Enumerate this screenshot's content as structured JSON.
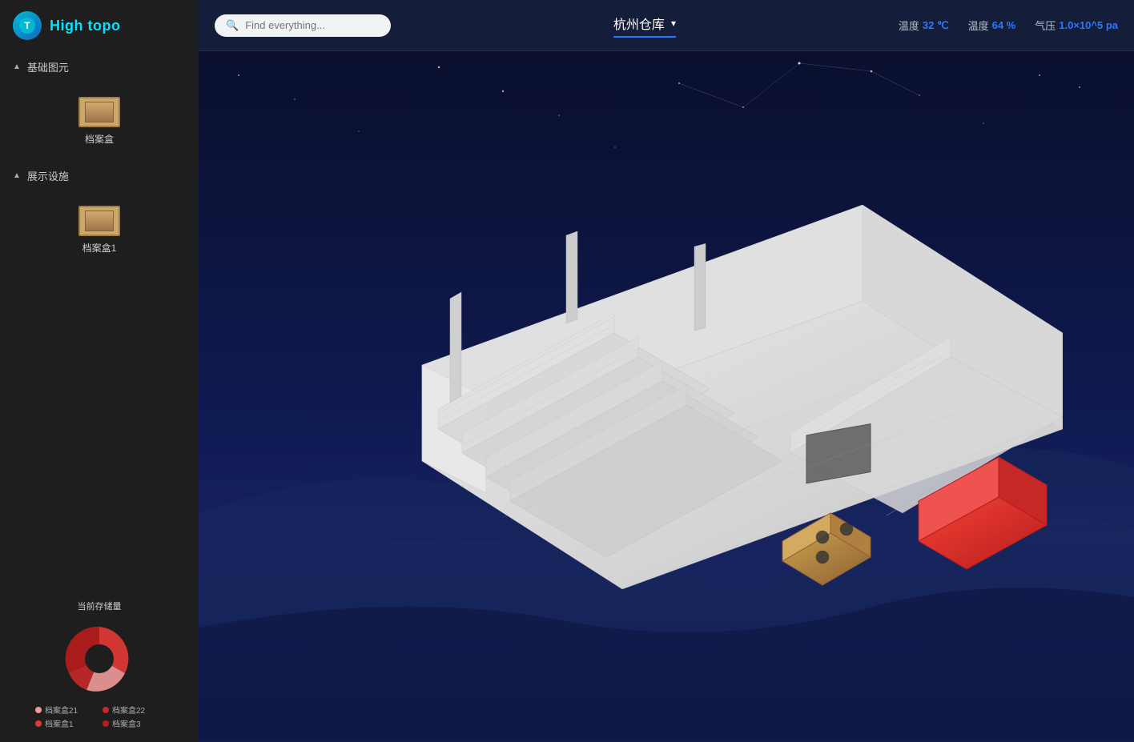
{
  "app": {
    "name": "High topo"
  },
  "header": {
    "search_placeholder": "Find everything...",
    "location": "杭州仓库",
    "stats": [
      {
        "label": "温度",
        "value": "32 ℃"
      },
      {
        "label": "温度",
        "value": "64 %"
      },
      {
        "label": "气压",
        "value": "1.0×10^5 pa"
      }
    ]
  },
  "sidebar": {
    "sections": [
      {
        "label": "基础图元",
        "items": [
          {
            "label": "档案盒"
          }
        ]
      },
      {
        "label": "展示设施",
        "items": [
          {
            "label": "档案盒1"
          }
        ]
      }
    ],
    "chart": {
      "title": "当前存储量",
      "segments": [
        {
          "label": "档案盒1",
          "color": "#e53935",
          "percent": 35
        },
        {
          "label": "档案盒21",
          "color": "#ef9a9a",
          "percent": 20
        },
        {
          "label": "档案盒22",
          "color": "#c62828",
          "percent": 15
        },
        {
          "label": "档案盒3",
          "color": "#b71c1c",
          "percent": 30
        }
      ]
    }
  }
}
